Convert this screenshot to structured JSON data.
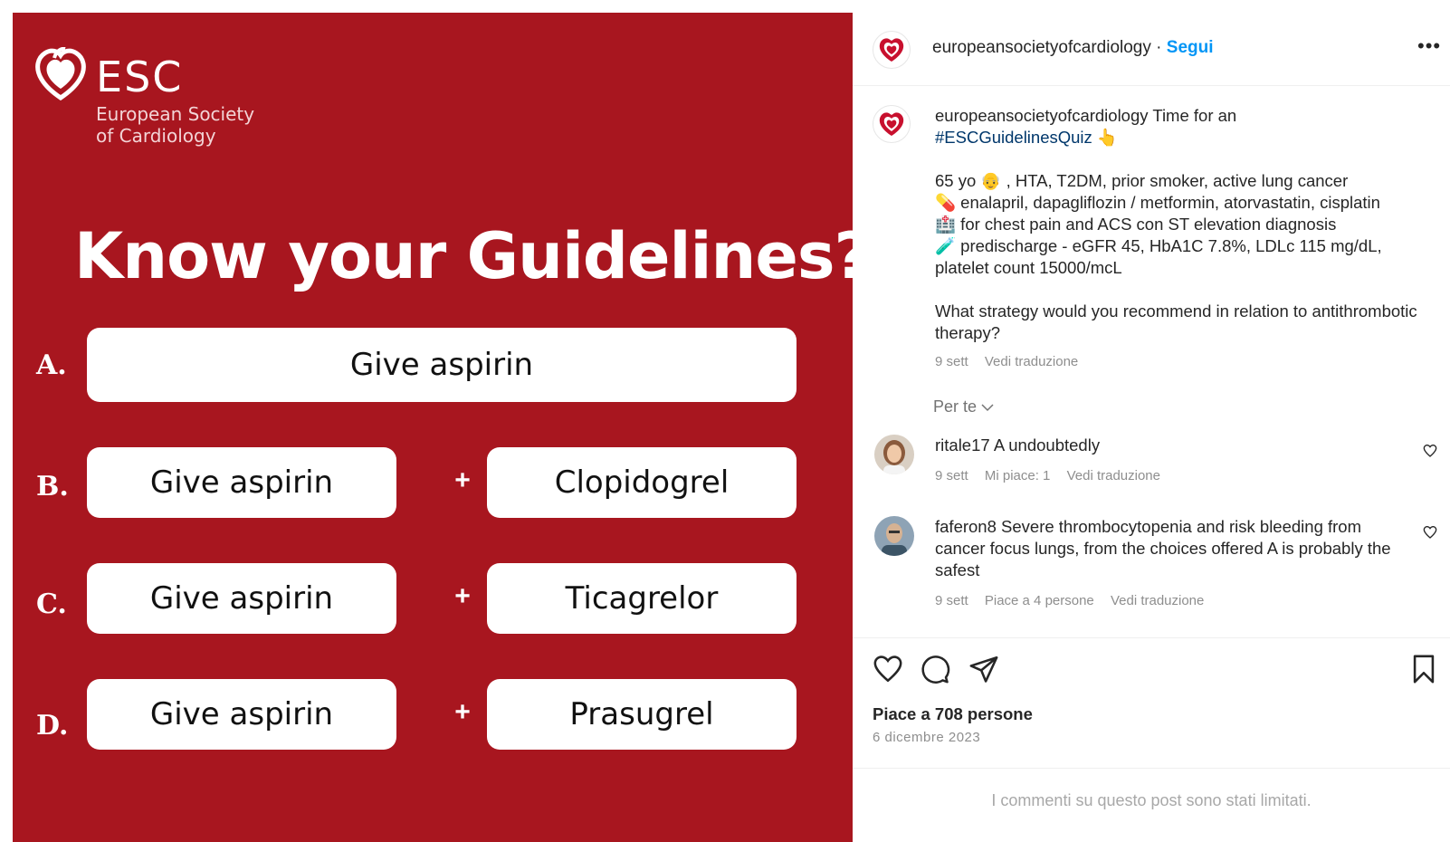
{
  "post_image": {
    "logo": {
      "acronym": "ESC",
      "subtitle_line1": "European Society",
      "subtitle_line2": "of Cardiology"
    },
    "headline": "Know your Guidelines?",
    "options": [
      {
        "letter": "A.",
        "left": "Give aspirin"
      },
      {
        "letter": "B.",
        "left": "Give aspirin",
        "plus": "+",
        "right": "Clopidogrel"
      },
      {
        "letter": "C.",
        "left": "Give aspirin",
        "plus": "+",
        "right": "Ticagrelor"
      },
      {
        "letter": "D.",
        "left": "Give aspirin",
        "plus": "+",
        "right": "Prasugrel"
      }
    ],
    "colors": {
      "background": "#a8161f",
      "box": "#ffffff"
    }
  },
  "header": {
    "username": "europeansocietyofcardiology",
    "separator": "·",
    "follow_label": "Segui",
    "more_icon": "more-horizontal-icon"
  },
  "caption": {
    "username": "europeansocietyofcardiology",
    "intro": "Time for an",
    "hashtag": "#ESCGuidelinesQuiz",
    "hashtag_emoji": "👆",
    "line1": "65 yo 👴 , HTA, T2DM, prior smoker, active lung cancer",
    "line2": "💊 enalapril, dapagliflozin / metformin, atorvastatin, cisplatin",
    "line3": "🏥 for chest pain and ACS con ST elevation diagnosis",
    "line4": "🧪 predischarge - eGFR 45, HbA1C 7.8%, LDLc 115 mg/dL,",
    "line5": "platelet count 15000/mcL",
    "question": "What strategy would you recommend in relation to antithrombotic therapy?",
    "time": "9 sett",
    "translate": "Vedi traduzione"
  },
  "for_you_label": "Per te",
  "comments": [
    {
      "username": "ritale17",
      "text": "A undoubtedly",
      "time": "9 sett",
      "likes": "Mi piace: 1",
      "translate": "Vedi traduzione"
    },
    {
      "username": "faferon8",
      "text": "Severe thrombocytopenia and risk bleeding from cancer focus lungs, from the choices offered A is probably the safest",
      "time": "9 sett",
      "likes": "Piace a 4 persone",
      "translate": "Vedi traduzione"
    }
  ],
  "actions": {
    "like_icon": "heart-icon",
    "comment_icon": "comment-icon",
    "share_icon": "send-icon",
    "save_icon": "bookmark-icon"
  },
  "likes_count": "Piace a 708 persone",
  "post_date": "6 dicembre 2023",
  "comments_limited": "I commenti su questo post sono stati limitati.",
  "colors": {
    "link": "#0095f6",
    "hashtag": "#00376b",
    "muted": "#8e8e8e"
  }
}
